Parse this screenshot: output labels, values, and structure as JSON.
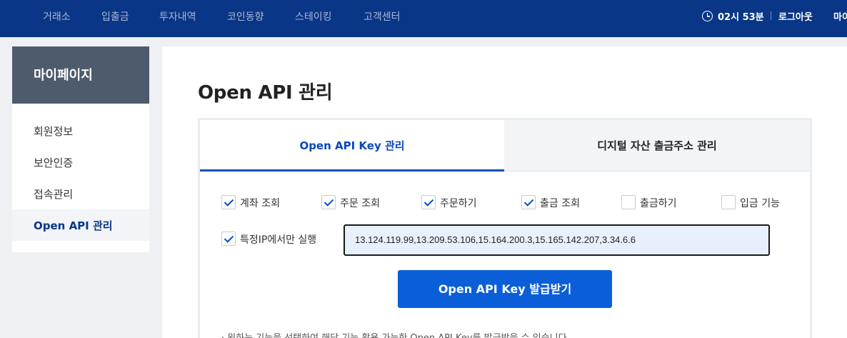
{
  "nav": {
    "items": [
      "거래소",
      "입출금",
      "투자내역",
      "코인동향",
      "스테이킹",
      "고객센터"
    ],
    "timer": "02시 53분",
    "logout": "로그아웃",
    "mypage": "마이"
  },
  "sidebar": {
    "title": "마이페이지",
    "items": [
      {
        "label": "회원정보"
      },
      {
        "label": "보안인증"
      },
      {
        "label": "접속관리"
      },
      {
        "label": "Open API 관리"
      }
    ],
    "active_index": 3
  },
  "main": {
    "title": "Open API 관리",
    "tabs": [
      {
        "label": "Open API Key 관리"
      },
      {
        "label": "디지털 자산 출금주소 관리"
      }
    ],
    "permissions": [
      {
        "label": "계좌 조회",
        "checked": true
      },
      {
        "label": "주문 조회",
        "checked": true
      },
      {
        "label": "주문하기",
        "checked": true
      },
      {
        "label": "출금 조회",
        "checked": true
      },
      {
        "label": "출금하기",
        "checked": false
      },
      {
        "label": "입금 기능",
        "checked": false
      }
    ],
    "ip_restrict": {
      "label": "특정IP에서만 실행",
      "checked": true
    },
    "ip_value": "13.124.119.99,13.209.53.106,15.164.200.3,15.165.142.207,3.34.6.6",
    "issue_button": "Open API Key 발급받기",
    "notice": "· 원하는 기능을 선택하여 해당 기능 활용 가능한 Open API Key를 발급받을 수 있습니다."
  },
  "colors": {
    "header": "#093687",
    "accent": "#0a5fd8",
    "sidebar_head": "#4e5b6c"
  }
}
